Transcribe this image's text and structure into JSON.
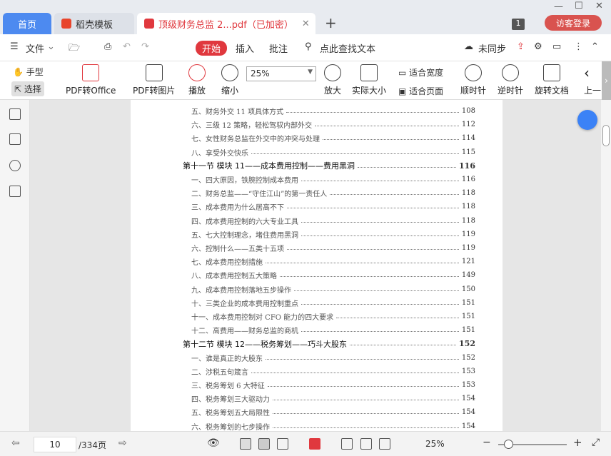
{
  "tabs": {
    "home": "首页",
    "t2": "稻壳模板",
    "t3": "顶级财务总监 2...pdf（已加密）",
    "badge": "1",
    "login": "访客登录"
  },
  "menu": {
    "file": "文件",
    "start": "开始",
    "insert": "插入",
    "annotate": "批注",
    "search": "点此查找文本",
    "sync": "未同步"
  },
  "toolbar": {
    "hand": "手型",
    "select": "选择",
    "pdf2office": "PDF转Office",
    "pdf2img": "PDF转图片",
    "play": "播放",
    "zoomout": "缩小",
    "zoom": "25%",
    "zoomin": "放大",
    "actual": "实际大小",
    "fitwidth": "适合宽度",
    "fitpage": "适合页面",
    "cw": "顺时针",
    "ccw": "逆时针",
    "rotate": "旋转文档",
    "prev": "上一"
  },
  "toc": [
    {
      "type": "sub",
      "text": "五、财务外交 11 项具体方式",
      "page": "108"
    },
    {
      "type": "sub",
      "text": "六、三级 12 策略，轻松驾驭内部外交",
      "page": "112"
    },
    {
      "type": "sub",
      "text": "七、女性财务总监在外交中的冲突与处理",
      "page": "114"
    },
    {
      "type": "sub",
      "text": "八、享受外交快乐",
      "page": "115"
    },
    {
      "type": "sec",
      "text": "第十一节  模块 11——成本费用控制——费用黑洞",
      "page": "116"
    },
    {
      "type": "sub",
      "text": "一、四大原因，铁腕控制成本费用",
      "page": "116"
    },
    {
      "type": "sub",
      "text": "二、财务总监——“守住江山”的第一责任人",
      "page": "118"
    },
    {
      "type": "sub",
      "text": "三、成本费用为什么居高不下",
      "page": "118"
    },
    {
      "type": "sub",
      "text": "四、成本费用控制的六大专业工具",
      "page": "118"
    },
    {
      "type": "sub",
      "text": "五、七大控制理念，堵住费用黑洞",
      "page": "119"
    },
    {
      "type": "sub",
      "text": "六、控制什么——五类十五项",
      "page": "119"
    },
    {
      "type": "sub",
      "text": "七、成本费用控制措施",
      "page": "121"
    },
    {
      "type": "sub",
      "text": "八、成本费用控制五大策略",
      "page": "149"
    },
    {
      "type": "sub",
      "text": "九、成本费用控制落地五步操作",
      "page": "150"
    },
    {
      "type": "sub",
      "text": "十、三类企业的成本费用控制重点",
      "page": "151"
    },
    {
      "type": "sub",
      "text": "十一、成本费用控制对 CFO 能力的四大要求",
      "page": "151"
    },
    {
      "type": "sub",
      "text": "十二、高费用——财务总监的商机",
      "page": "151"
    },
    {
      "type": "sec",
      "text": "第十二节  模块 12——税务筹划——巧斗大股东",
      "page": "152"
    },
    {
      "type": "sub",
      "text": "一、谁是真正的大股东",
      "page": "152"
    },
    {
      "type": "sub",
      "text": "二、涉税五句箴言",
      "page": "153"
    },
    {
      "type": "sub",
      "text": "三、税务筹划 6 大特征",
      "page": "153"
    },
    {
      "type": "sub",
      "text": "四、税务筹划三大驱动力",
      "page": "154"
    },
    {
      "type": "sub",
      "text": "五、税务筹划五大局限性",
      "page": "154"
    },
    {
      "type": "sub",
      "text": "六、税务筹划的七步操作",
      "page": "154"
    }
  ],
  "status": {
    "page": "10",
    "total": "/334页",
    "zoom": "25%"
  }
}
